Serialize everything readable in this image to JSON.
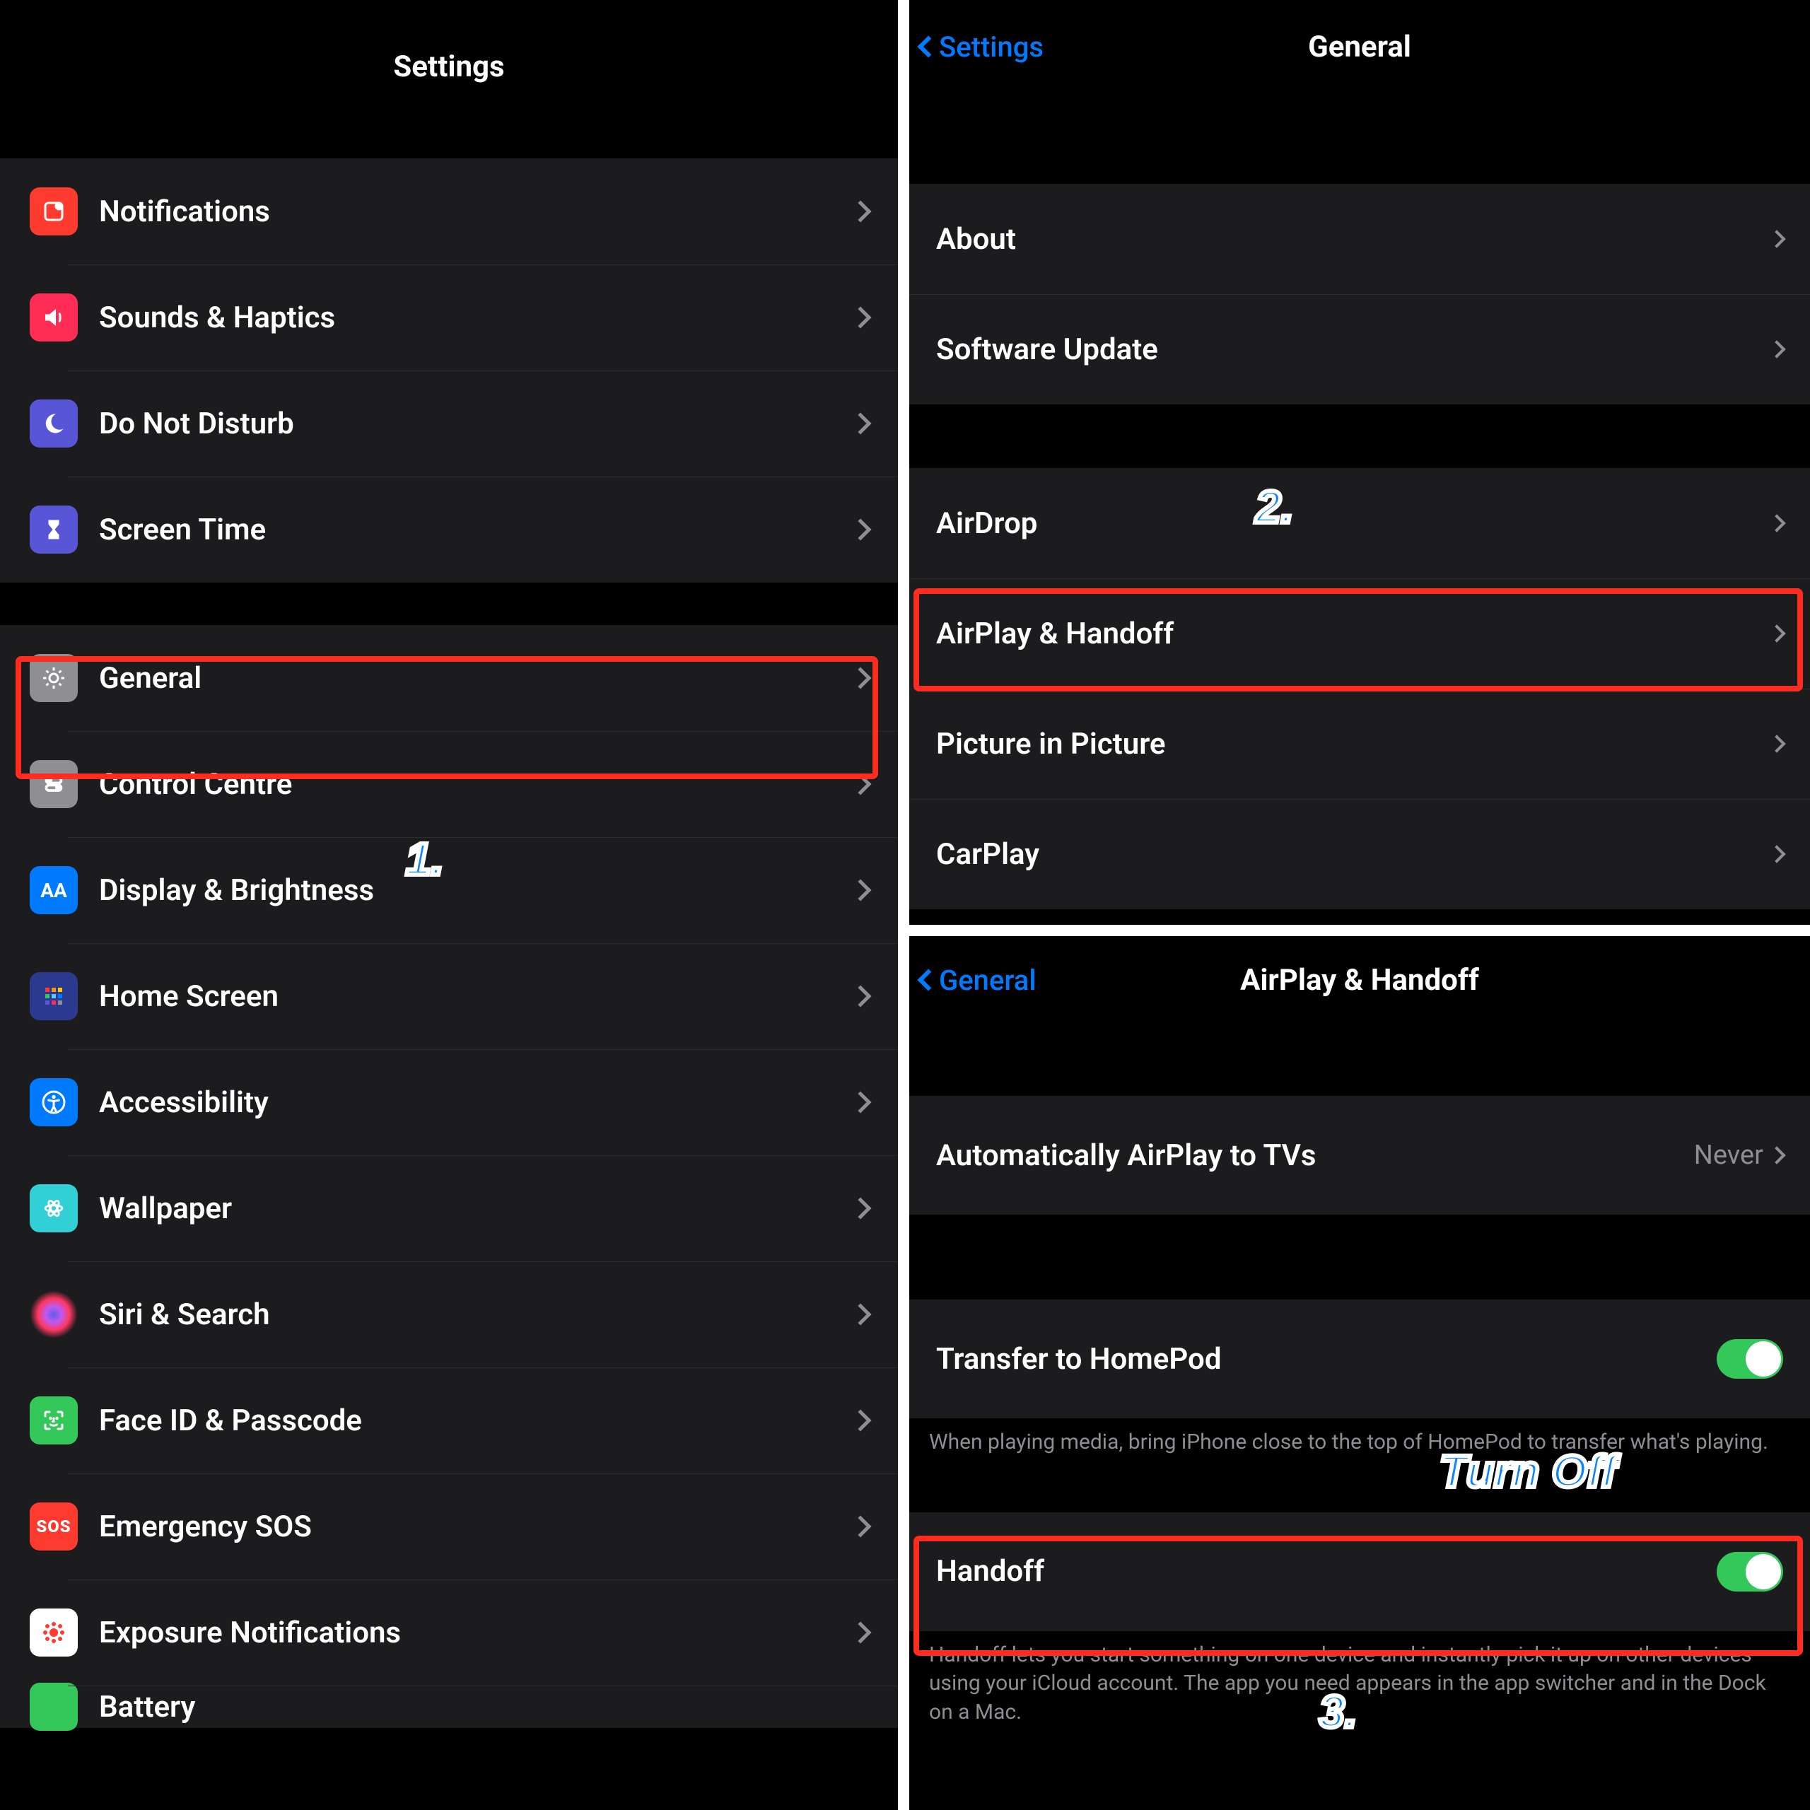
{
  "panel1": {
    "nav_title": "Settings",
    "groups": [
      [
        {
          "id": "notifications",
          "label": "Notifications",
          "icon": "notifications",
          "color": "#ff3b30"
        },
        {
          "id": "sounds",
          "label": "Sounds & Haptics",
          "icon": "sounds",
          "color": "#ff2d55"
        },
        {
          "id": "dnd",
          "label": "Do Not Disturb",
          "icon": "dnd",
          "color": "#5856d6"
        },
        {
          "id": "screentime",
          "label": "Screen Time",
          "icon": "screentime",
          "color": "#5856d6"
        }
      ],
      [
        {
          "id": "general",
          "label": "General",
          "icon": "general",
          "color": "#8e8e93",
          "highlight": true
        },
        {
          "id": "controlcentre",
          "label": "Control Centre",
          "icon": "controlcentre",
          "color": "#8e8e93"
        },
        {
          "id": "display",
          "label": "Display & Brightness",
          "icon": "display",
          "color": "#007AFF"
        },
        {
          "id": "homescreen",
          "label": "Home Screen",
          "icon": "homescreen",
          "color": "#3a3a8f"
        },
        {
          "id": "accessibility",
          "label": "Accessibility",
          "icon": "accessibility",
          "color": "#007AFF"
        },
        {
          "id": "wallpaper",
          "label": "Wallpaper",
          "icon": "wallpaper",
          "color": "#30d0d6"
        },
        {
          "id": "siri",
          "label": "Siri & Search",
          "icon": "siri",
          "color": "#1c1c1e"
        },
        {
          "id": "faceid",
          "label": "Face ID & Passcode",
          "icon": "faceid",
          "color": "#34C759"
        },
        {
          "id": "sos",
          "label": "Emergency SOS",
          "icon": "sos",
          "color": "#ff3b30"
        },
        {
          "id": "exposure",
          "label": "Exposure Notifications",
          "icon": "exposure",
          "color": "#ffffff"
        },
        {
          "id": "battery",
          "label": "Battery",
          "icon": "battery",
          "color": "#34C759"
        }
      ]
    ],
    "step_badge": "1."
  },
  "panel2": {
    "back_label": "Settings",
    "nav_title": "General",
    "groups": [
      [
        {
          "id": "about",
          "label": "About"
        },
        {
          "id": "swupdate",
          "label": "Software Update"
        }
      ],
      [
        {
          "id": "airdrop",
          "label": "AirDrop"
        },
        {
          "id": "airplay",
          "label": "AirPlay & Handoff",
          "highlight": true
        },
        {
          "id": "pip",
          "label": "Picture in Picture"
        },
        {
          "id": "carplay",
          "label": "CarPlay"
        }
      ]
    ],
    "step_badge": "2."
  },
  "panel3": {
    "back_label": "General",
    "nav_title": "AirPlay & Handoff",
    "groups": [
      {
        "rows": [
          {
            "id": "autoairplay",
            "label": "Automatically AirPlay to TVs",
            "value": "Never",
            "type": "disclosure"
          }
        ]
      },
      {
        "rows": [
          {
            "id": "transferhomepod",
            "label": "Transfer to HomePod",
            "type": "switch",
            "on": true
          }
        ],
        "footer": "When playing media, bring iPhone close to the top of HomePod to transfer what's playing."
      },
      {
        "rows": [
          {
            "id": "handoff",
            "label": "Handoff",
            "type": "switch",
            "on": true,
            "highlight": true
          }
        ],
        "footer": "Handoff lets you start something on one device and instantly pick it up on other devices using your iCloud account. The app you need appears in the app switcher and in the Dock on a Mac."
      }
    ],
    "step_badge": "3.",
    "callout": "Turn Off"
  }
}
